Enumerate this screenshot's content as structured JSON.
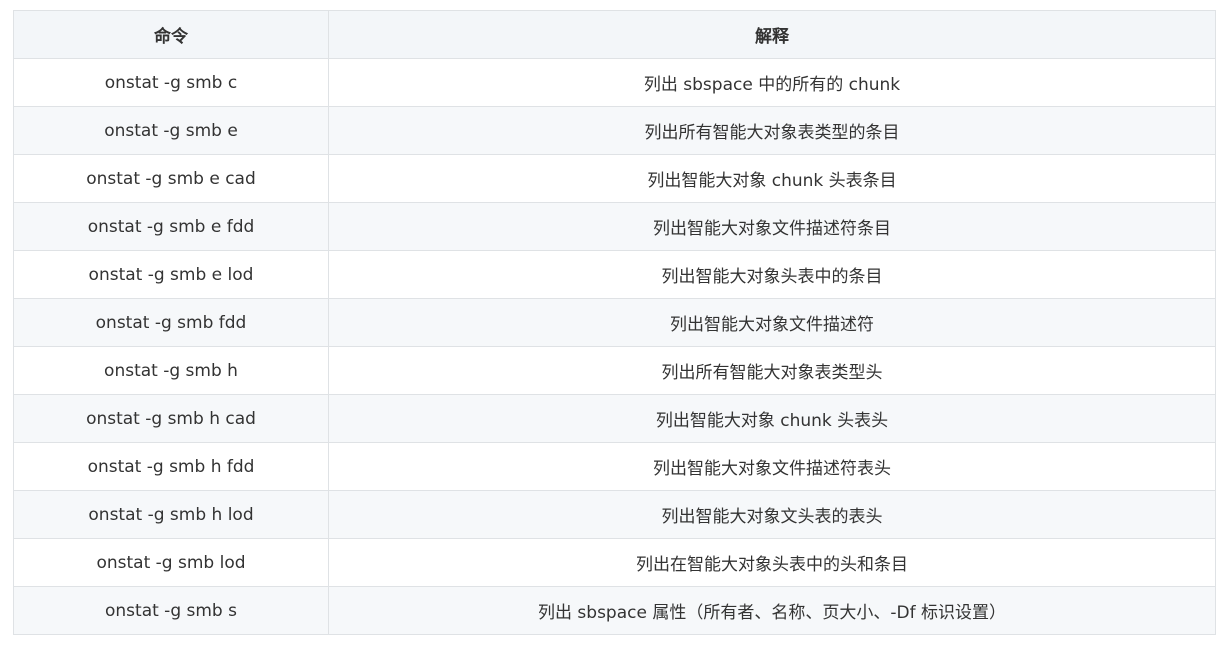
{
  "table": {
    "headers": [
      "命令",
      "解释"
    ],
    "rows": [
      [
        "onstat -g smb c",
        "列出 sbspace 中的所有的 chunk"
      ],
      [
        "onstat -g smb e",
        "列出所有智能大对象表类型的条目"
      ],
      [
        "onstat -g smb e cad",
        "列出智能大对象 chunk 头表条目"
      ],
      [
        "onstat -g smb e fdd",
        "列出智能大对象文件描述符条目"
      ],
      [
        "onstat -g smb e lod",
        "列出智能大对象头表中的条目"
      ],
      [
        "onstat -g smb fdd",
        "列出智能大对象文件描述符"
      ],
      [
        "onstat -g smb h",
        "列出所有智能大对象表类型头"
      ],
      [
        "onstat -g smb h cad",
        "列出智能大对象 chunk 头表头"
      ],
      [
        "onstat -g smb h fdd",
        "列出智能大对象文件描述符表头"
      ],
      [
        "onstat -g smb h lod",
        "列出智能大对象文头表的表头"
      ],
      [
        "onstat -g smb lod",
        "列出在智能大对象头表中的头和条目"
      ],
      [
        "onstat -g smb s",
        "列出 sbspace 属性（所有者、名称、页大小、-Df 标识设置）"
      ]
    ]
  }
}
